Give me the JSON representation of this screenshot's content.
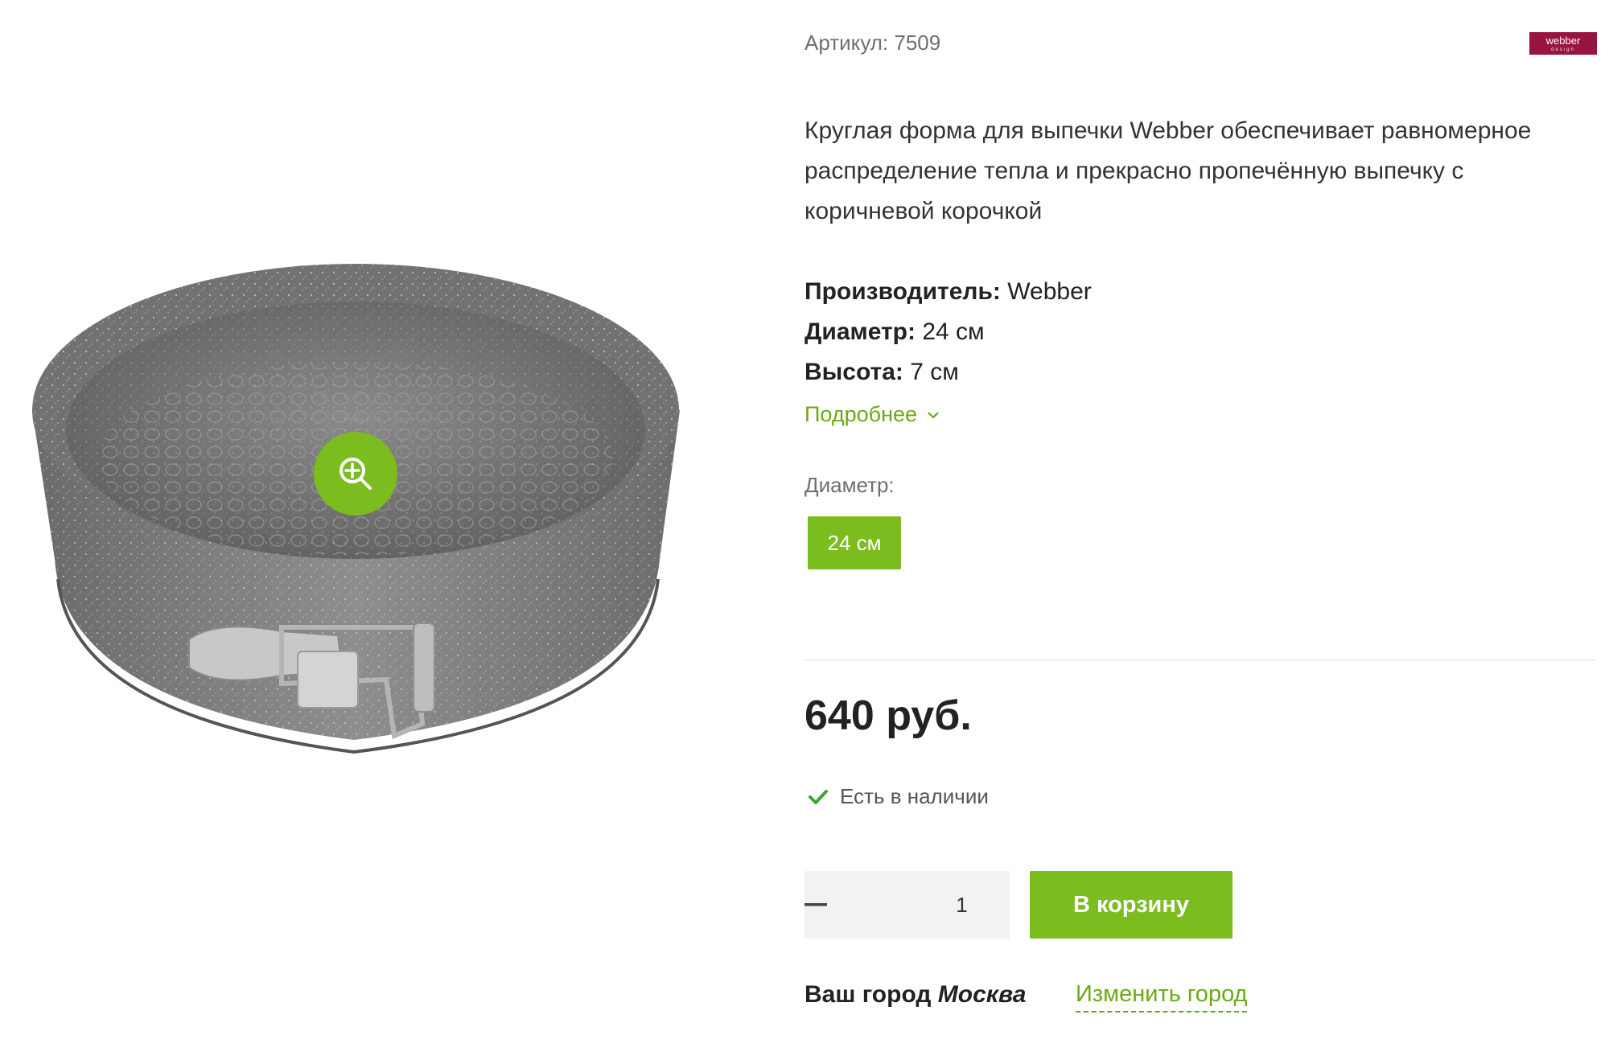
{
  "product": {
    "article_label": "Артикул:",
    "article_number": "7509",
    "brand_logo": {
      "text": "webber",
      "subtext": "design"
    },
    "description": "Круглая форма для выпечки Webber обеспечивает равномерное распределение тепла и прекрасно пропечённую выпечку с коричневой корочкой",
    "specs": [
      {
        "label": "Производитель:",
        "value": "Webber"
      },
      {
        "label": "Диаметр:",
        "value": "24 см"
      },
      {
        "label": "Высота:",
        "value": "7 см"
      }
    ],
    "more_link": "Подробнее",
    "option_label": "Диаметр:",
    "options": [
      {
        "label": "24 см",
        "selected": true
      }
    ],
    "price": "640 руб.",
    "stock_status": "Есть в наличии",
    "quantity": "1",
    "add_to_cart": "В корзину",
    "city_label": "Ваш город",
    "city_name": "Москва",
    "change_city": "Изменить город"
  },
  "icons": {
    "zoom": "zoom-in-icon",
    "chevron": "chevron-down-icon",
    "check": "check-icon",
    "minus": "minus-icon",
    "plus": "plus-icon"
  },
  "colors": {
    "accent": "#7bbc1f",
    "accent_text": "#6aaa16",
    "brand": "#96163f"
  }
}
